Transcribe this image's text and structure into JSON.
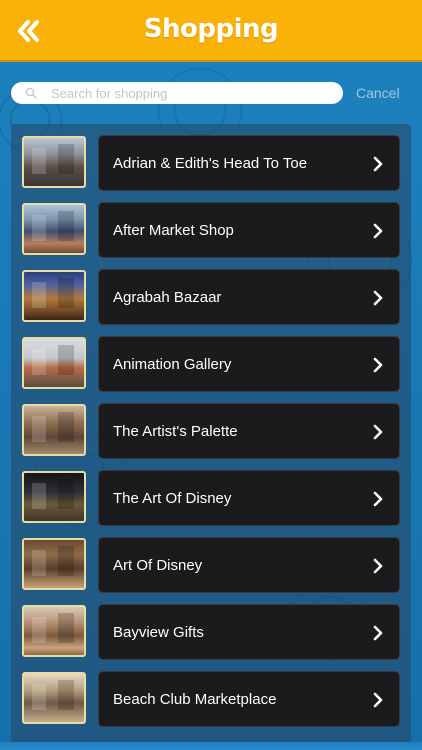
{
  "header": {
    "title": "Shopping",
    "back_icon": "double-chevron-left-icon",
    "background_color": "#f9b208"
  },
  "search": {
    "placeholder": "Search for shopping",
    "value": "",
    "cancel_label": "Cancel"
  },
  "list": {
    "items": [
      {
        "label": "Adrian & Edith's Head To Toe"
      },
      {
        "label": "After Market Shop"
      },
      {
        "label": "Agrabah Bazaar"
      },
      {
        "label": "Animation Gallery"
      },
      {
        "label": "The Artist's Palette"
      },
      {
        "label": "The Art Of Disney"
      },
      {
        "label": "Art Of Disney"
      },
      {
        "label": "Bayview Gifts"
      },
      {
        "label": "Beach Club Marketplace"
      }
    ],
    "chevron_icon": "chevron-right-icon"
  }
}
